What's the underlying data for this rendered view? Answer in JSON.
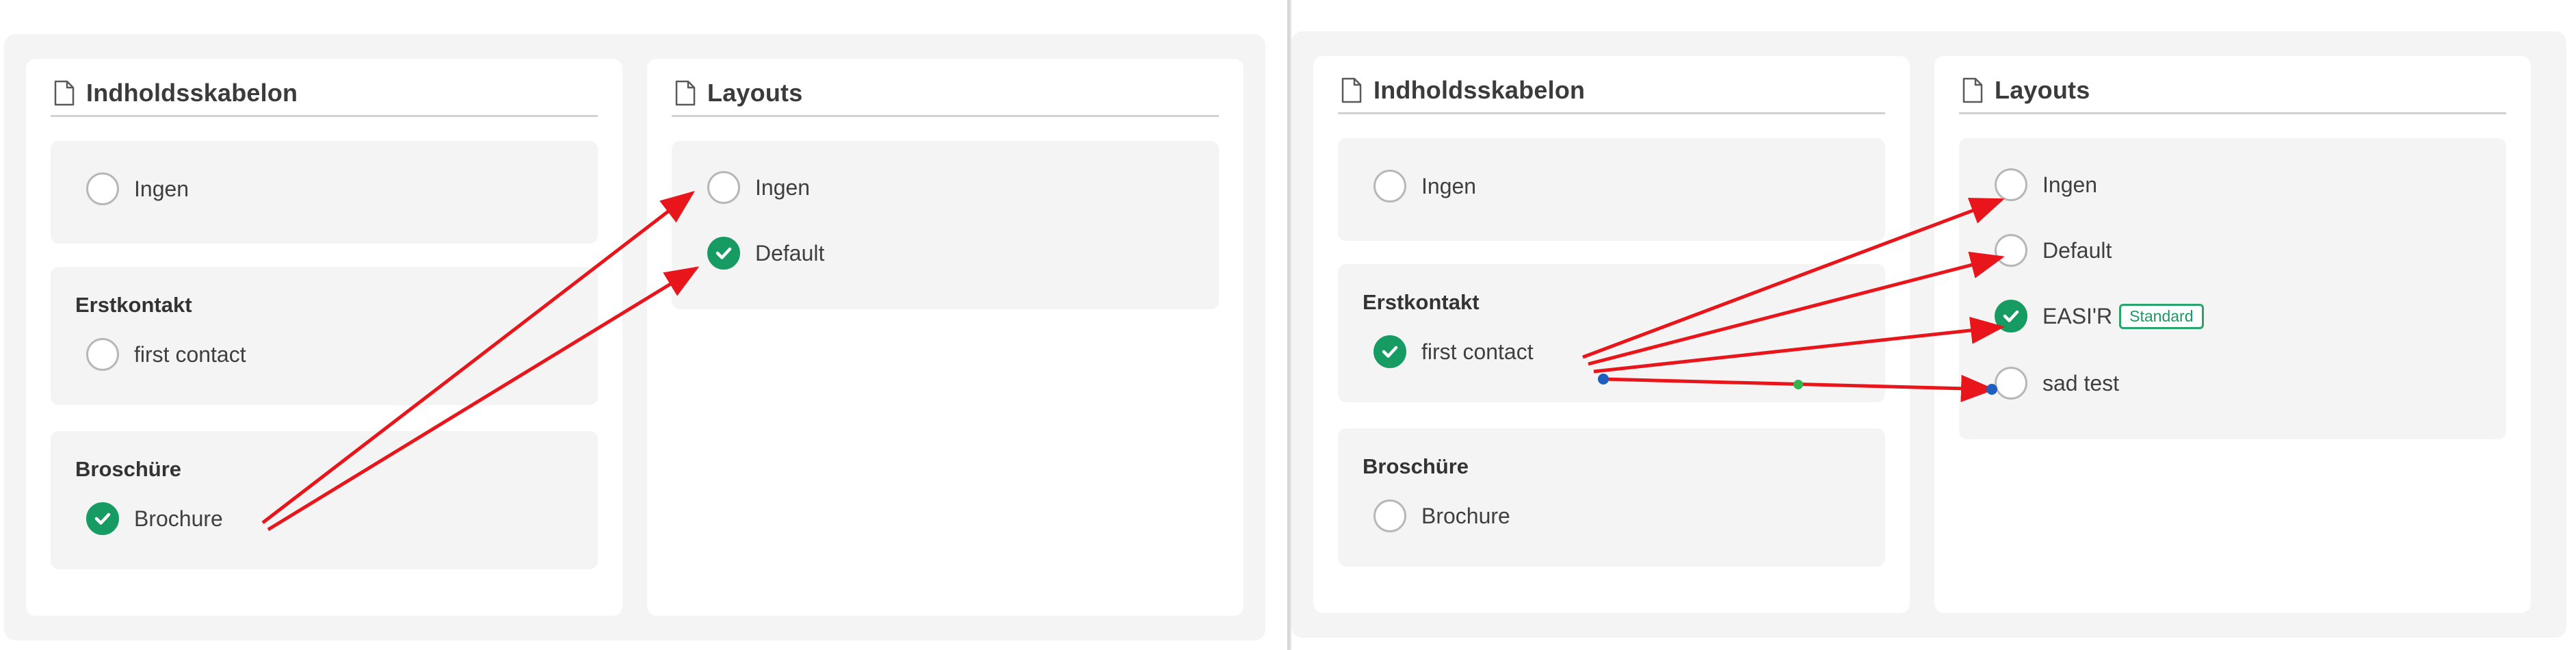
{
  "left": {
    "templates": {
      "title": "Indholdsskabelon",
      "icon": "document-icon",
      "none_option": {
        "label": "Ingen",
        "selected": false
      },
      "groups": [
        {
          "title": "Erstkontakt",
          "option": {
            "label": "first contact",
            "selected": false
          }
        },
        {
          "title": "Broschüre",
          "option": {
            "label": "Brochure",
            "selected": true
          }
        }
      ]
    },
    "layouts": {
      "title": "Layouts",
      "icon": "document-icon",
      "options": [
        {
          "label": "Ingen",
          "selected": false
        },
        {
          "label": "Default",
          "selected": true
        }
      ]
    }
  },
  "right": {
    "templates": {
      "title": "Indholdsskabelon",
      "icon": "document-icon",
      "none_option": {
        "label": "Ingen",
        "selected": false
      },
      "groups": [
        {
          "title": "Erstkontakt",
          "option": {
            "label": "first contact",
            "selected": true
          }
        },
        {
          "title": "Broschüre",
          "option": {
            "label": "Brochure",
            "selected": false
          }
        }
      ]
    },
    "layouts": {
      "title": "Layouts",
      "icon": "document-icon",
      "options": [
        {
          "label": "Ingen",
          "selected": false
        },
        {
          "label": "Default",
          "selected": false
        },
        {
          "label": "EASI'R",
          "selected": true,
          "badge": "Standard"
        },
        {
          "label": "sad test",
          "selected": false
        }
      ]
    }
  },
  "colors": {
    "selected_green": "#169b62",
    "annotation_arrow": "#e8151b",
    "annotation_handle_blue": "#1f5fbf",
    "annotation_handle_green": "#33b54a"
  }
}
